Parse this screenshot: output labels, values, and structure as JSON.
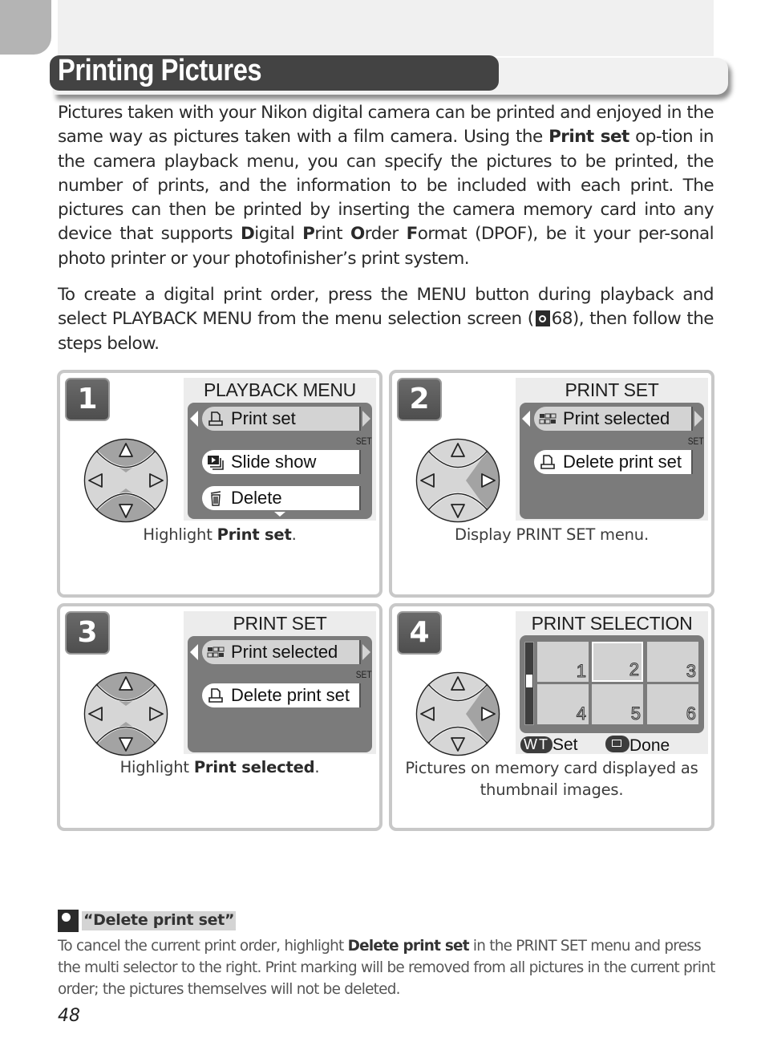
{
  "page": {
    "title": "Printing Pictures",
    "page_number": "48"
  },
  "intro": {
    "p1_a": "Pictures taken with your Nikon digital camera can be printed and enjoyed in the same way as pictures taken with a film camera.  Using the ",
    "p1_bold": "Print set",
    "p1_b": " op-tion in the camera playback menu, you can specify the pictures to be printed, the number of prints, and the information to be included with each print. The pictures can then be printed by inserting the camera memory card into any device that supports ",
    "dpof": [
      {
        "cap": "D",
        "rest": "igital "
      },
      {
        "cap": "P",
        "rest": "rint "
      },
      {
        "cap": "O",
        "rest": "rder "
      },
      {
        "cap": "F",
        "rest": "ormat"
      }
    ],
    "p1_c": " (DPOF), be it your per-sonal photo printer or your photofinisher’s print system.",
    "p2_a": "To create a digital print order, press the MENU button during playback and select PLAYBACK MENU from the menu selection screen (",
    "p2_ref": "68",
    "p2_b": "), then follow the steps below."
  },
  "steps": [
    {
      "number": "1",
      "screen_title": "PLAYBACK MENU",
      "menu_items": [
        {
          "icon": "print-set-icon",
          "label": "Print set",
          "selected": true
        },
        {
          "icon": "slide-show-icon",
          "label": "Slide show",
          "selected": false
        },
        {
          "icon": "trash-icon",
          "label": "Delete",
          "selected": false
        }
      ],
      "set_label": "SET",
      "dpad_active": "up-down",
      "caption_a": "Highlight ",
      "caption_bold": "Print set",
      "caption_b": "."
    },
    {
      "number": "2",
      "screen_title": "PRINT SET",
      "menu_items": [
        {
          "icon": "print-selected-icon",
          "label": "Print selected",
          "selected": true
        },
        {
          "icon": "print-set-icon",
          "label": "Delete print set",
          "selected": false
        }
      ],
      "set_label": "SET",
      "dpad_active": "right",
      "caption_a": "Display PRINT SET menu.",
      "caption_bold": "",
      "caption_b": ""
    },
    {
      "number": "3",
      "screen_title": "PRINT SET",
      "menu_items": [
        {
          "icon": "print-selected-icon",
          "label": "Print selected",
          "selected": true
        },
        {
          "icon": "print-set-icon",
          "label": "Delete print set",
          "selected": false
        }
      ],
      "set_label": "SET",
      "dpad_active": "up-down",
      "caption_a": "Highlight ",
      "caption_bold": "Print selected",
      "caption_b": "."
    },
    {
      "number": "4",
      "screen_title": "PRINT SELECTION",
      "thumbnails": [
        "1",
        "2",
        "3",
        "4",
        "5",
        "6"
      ],
      "highlighted_thumbnail": "2",
      "legend_wt": "WT",
      "legend_set": "Set",
      "legend_done": "Done",
      "dpad_active": "right",
      "caption_a": "Pictures on memory card displayed as thumbnail images.",
      "caption_bold": "",
      "caption_b": ""
    }
  ],
  "tip": {
    "icon": "magnifier-tip-icon",
    "title": "“Delete print set”",
    "body_a": "To cancel the current print order, highlight ",
    "body_bold": "Delete print set",
    "body_b": " in the PRINT SET menu and press the multi selector to the right.  Print marking will be removed from all pictures in the current print order; the pictures themselves will not be deleted."
  },
  "colors": {
    "title_bar": "#434343",
    "screen_panel": "#7b7b7b",
    "selected_item": "#d3d3d3",
    "card_border": "#c8c8c8"
  }
}
